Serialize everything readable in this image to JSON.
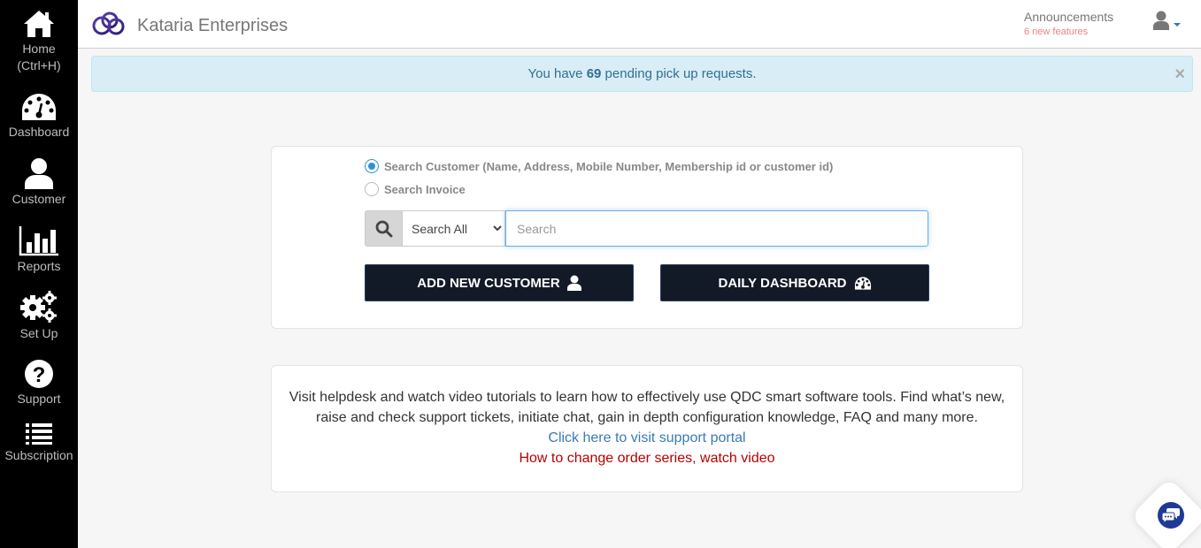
{
  "sidebar": {
    "items": [
      {
        "label": "Home",
        "sublabel": "(Ctrl+H)",
        "icon": "home-icon"
      },
      {
        "label": "Dashboard",
        "icon": "dashboard-gauge-icon"
      },
      {
        "label": "Customer",
        "icon": "user-icon"
      },
      {
        "label": "Reports",
        "icon": "bar-chart-icon"
      },
      {
        "label": "Set Up",
        "icon": "gears-icon"
      },
      {
        "label": "Support",
        "icon": "question-circle-icon"
      },
      {
        "label": "Subscription",
        "icon": "list-icon"
      }
    ]
  },
  "header": {
    "brand": "Kataria Enterprises",
    "announcements": {
      "title": "Announcements",
      "subtitle": "6 new features"
    }
  },
  "alert": {
    "prefix": "You have ",
    "count": "69",
    "suffix": " pending pick up requests.",
    "close": "×"
  },
  "search": {
    "options": [
      {
        "label": "Search Customer (Name, Address, Mobile Number, Membership id or customer id)",
        "checked": true
      },
      {
        "label": "Search Invoice",
        "checked": false
      }
    ],
    "scope_selected": "Search All",
    "placeholder": "Search",
    "value": ""
  },
  "buttons": {
    "add_customer": "ADD NEW CUSTOMER",
    "daily_dashboard": "DAILY DASHBOARD"
  },
  "help": {
    "text_line1": "Visit helpdesk and watch video tutorials to learn how to effectively use QDC smart software tools. Find what’s new,",
    "text_line2": "raise and check support tickets, initiate chat, gain in depth configuration knowledge, FAQ and many more.",
    "support_link": "Click here to visit support portal",
    "video_link": "How to change order series, watch video"
  },
  "colors": {
    "sidebar_bg": "#000000",
    "alert_bg": "#d9edf7",
    "alert_text": "#31708f",
    "button_dark": "#111a26",
    "link_blue": "#3a7ab8",
    "link_red": "#b80000",
    "announce_red": "#ef7f7f",
    "chat_blue": "#1e3a96"
  }
}
